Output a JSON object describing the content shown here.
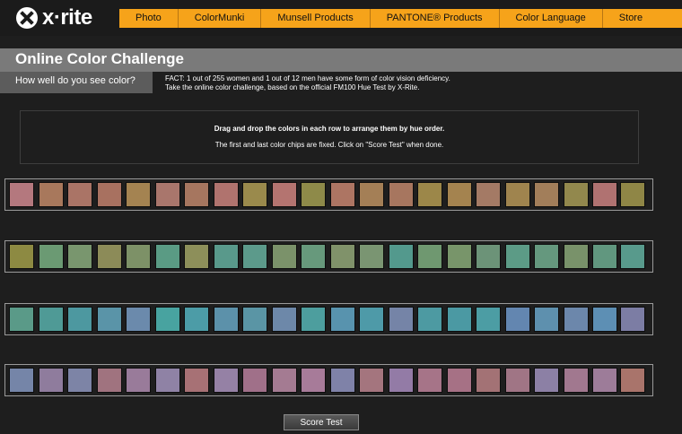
{
  "brand": {
    "logo_text": "x·rite"
  },
  "nav": [
    "Photo",
    "ColorMunki",
    "Munsell Products",
    "PANTONE® Products",
    "Color Language",
    "Store"
  ],
  "page": {
    "title": "Online Color Challenge",
    "subtitle": "How well do you see color?",
    "fact_line1": "FACT: 1 out of 255 women and 1 out of 12 men have some form of color vision deficiency.",
    "fact_line2": "Take the online color challenge, based on the official FM100 Hue Test by X-Rite."
  },
  "instructions": {
    "line1": "Drag and drop the colors in each row to arrange them by hue order.",
    "line2": "The first and last color chips are fixed. Click on \"Score Test\" when done."
  },
  "rows": [
    [
      "#b4787e",
      "#a8785c",
      "#aa7466",
      "#a87160",
      "#a48351",
      "#a9766c",
      "#a6765f",
      "#b0736e",
      "#9a8a4c",
      "#b47470",
      "#8e8a49",
      "#ad7563",
      "#a47f56",
      "#a7765f",
      "#9c8749",
      "#a4834f",
      "#a47a65",
      "#9f844e",
      "#a27e5a",
      "#92884d",
      "#b07271",
      "#8f8646"
    ],
    [
      "#8d8a42",
      "#6b9a73",
      "#79966e",
      "#8c8b58",
      "#7d9167",
      "#5a9b84",
      "#8d8f5a",
      "#59998b",
      "#5c9a8b",
      "#7b926a",
      "#67997c",
      "#80926a",
      "#7a9572",
      "#53998d",
      "#6f9870",
      "#78956a",
      "#6c9378",
      "#5c9b86",
      "#65987e",
      "#79926a",
      "#61977f",
      "#589a8c"
    ],
    [
      "#5a9a88",
      "#4f9a96",
      "#4d98a0",
      "#5a94a8",
      "#6b8aac",
      "#48a3a0",
      "#4c9ca7",
      "#5c91aa",
      "#5a95a5",
      "#6d88a9",
      "#4d9e9e",
      "#5893ae",
      "#4e9aa8",
      "#7584a7",
      "#4d9aa2",
      "#4b99a3",
      "#4c9da4",
      "#6386b0",
      "#5e90ae",
      "#6c87ab",
      "#5d8fb4",
      "#7c7da4"
    ],
    [
      "#7585a8",
      "#8f7c9d",
      "#7d84a6",
      "#a0737f",
      "#997b9a",
      "#8f82a5",
      "#a77175",
      "#9581a5",
      "#a07089",
      "#a47b92",
      "#a77b99",
      "#7f82a8",
      "#a4757e",
      "#937ba6",
      "#a67488",
      "#a67185",
      "#a37275",
      "#a07585",
      "#8c80a5",
      "#a1788f",
      "#9d7c99",
      "#a9746b"
    ]
  ],
  "button": {
    "score_label": "Score Test"
  }
}
